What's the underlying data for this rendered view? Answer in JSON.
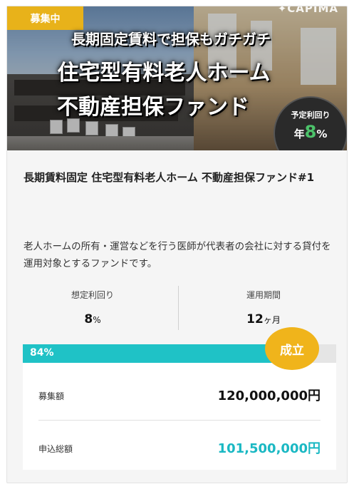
{
  "hero": {
    "status_badge": "募集中",
    "logo_text": "✦CAPIMA",
    "headline_1": "長期固定賃料で担保もガチガチ",
    "headline_2": "住宅型有料老人ホーム",
    "headline_3": "不動産担保ファンド",
    "yield_label": "予定利回り",
    "yield_prefix": "年",
    "yield_number": "8",
    "yield_unit": "%"
  },
  "fund": {
    "title": "長期賃料固定 住宅型有料老人ホーム 不動産担保ファンド#1",
    "description": "老人ホームの所有・運営などを行う医師が代表者の会社に対する貸付を運用対象とするファンドです。"
  },
  "stats": {
    "yield_label": "想定利回り",
    "yield_value": "8",
    "yield_unit": "%",
    "period_label": "運用期間",
    "period_value": "12",
    "period_unit": "ヶ月"
  },
  "progress": {
    "percent_text": "84%",
    "fraction": 0.84,
    "status_label": "成立"
  },
  "amounts": {
    "target_label": "募集額",
    "target_value": "120,000,000円",
    "applied_label": "申込総額",
    "applied_value": "101,500,000円"
  },
  "colors": {
    "badge": "#e8b21a",
    "progress": "#1fc2c6",
    "accent_cyan": "#1ab8c3",
    "yield_green": "#4cc26a"
  }
}
